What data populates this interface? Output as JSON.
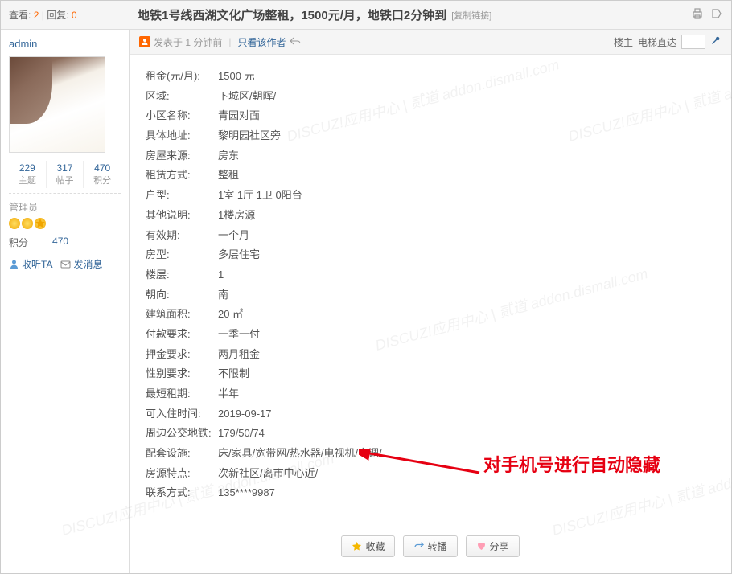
{
  "header": {
    "views_label": "查看:",
    "views": "2",
    "replies_label": "回复:",
    "replies": "0",
    "title": "地铁1号线西湖文化广场整租，1500元/月，地铁口2分钟到",
    "copy_link": "[复制链接]"
  },
  "sidebar": {
    "username": "admin",
    "stats": [
      {
        "num": "229",
        "label": "主题"
      },
      {
        "num": "317",
        "label": "帖子"
      },
      {
        "num": "470",
        "label": "积分"
      }
    ],
    "rank": "管理员",
    "credit_label": "积分",
    "credit_value": "470",
    "follow_label": "收听TA",
    "msg_label": "发消息"
  },
  "post_meta": {
    "posted_prefix": "发表于",
    "posted_time": "1 分钟前",
    "only_author": "只看该作者",
    "floor": "楼主",
    "elevator": "电梯直达"
  },
  "details": [
    {
      "label": "租金(元/月):",
      "value": "1500 元"
    },
    {
      "label": "区域:",
      "value": "下城区/朝晖/"
    },
    {
      "label": "小区名称:",
      "value": "青园对面"
    },
    {
      "label": "具体地址:",
      "value": "黎明园社区旁"
    },
    {
      "label": "房屋来源:",
      "value": "房东"
    },
    {
      "label": "租赁方式:",
      "value": "整租"
    },
    {
      "label": "户型:",
      "value": "1室 1厅 1卫 0阳台"
    },
    {
      "label": "其他说明:",
      "value": "1楼房源"
    },
    {
      "label": "有效期:",
      "value": "一个月"
    },
    {
      "label": "房型:",
      "value": "多层住宅"
    },
    {
      "label": "楼层:",
      "value": "1"
    },
    {
      "label": "朝向:",
      "value": "南"
    },
    {
      "label": "建筑面积:",
      "value": "20 ㎡"
    },
    {
      "label": "付款要求:",
      "value": "一季一付"
    },
    {
      "label": "押金要求:",
      "value": "两月租金"
    },
    {
      "label": "性别要求:",
      "value": "不限制"
    },
    {
      "label": "最短租期:",
      "value": "半年"
    },
    {
      "label": "可入住时间:",
      "value": "2019-09-17"
    },
    {
      "label": "周边公交地铁:",
      "value": "179/50/74"
    },
    {
      "label": "配套设施:",
      "value": "床/家具/宽带网/热水器/电视机/空调/"
    },
    {
      "label": "房源特点:",
      "value": "次新社区/离市中心近/"
    },
    {
      "label": "联系方式:",
      "value": "135****9987"
    }
  ],
  "annotation": "对手机号进行自动隐藏",
  "footer": {
    "fav": "收藏",
    "share": "转播",
    "share2": "分享"
  },
  "watermark": "DISCUZ!应用中心 | 贰道 addon.dismall.com"
}
